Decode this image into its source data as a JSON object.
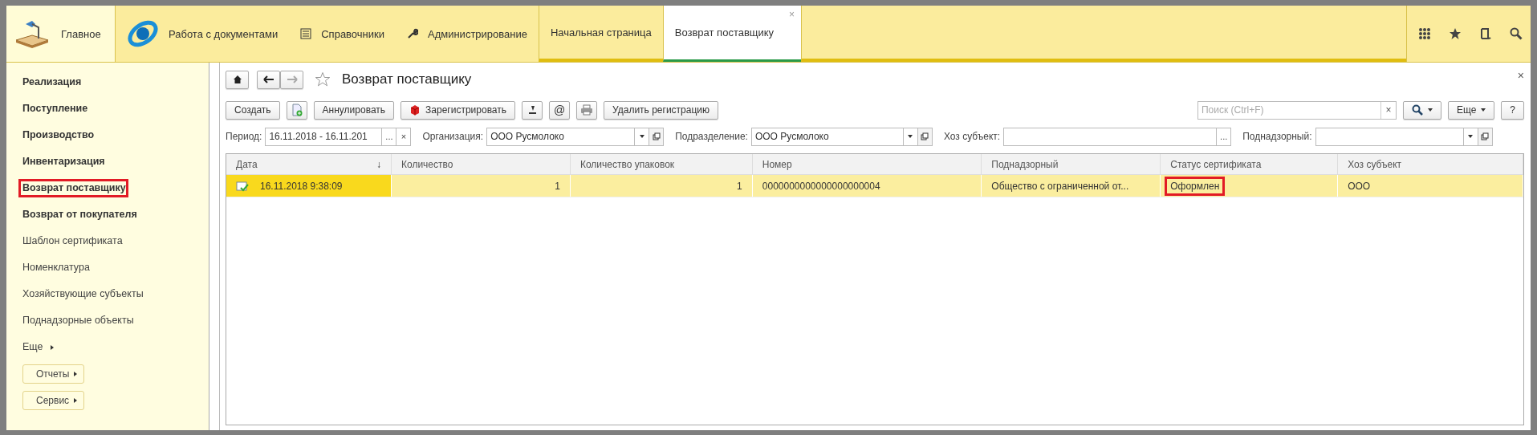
{
  "top_bar": {
    "home": {
      "label": "Главное",
      "selected": true
    },
    "sections": [
      {
        "label": "Работа с документами",
        "kind": "logo"
      },
      {
        "label": "Справочники",
        "kind": "list"
      },
      {
        "label": "Администрирование",
        "kind": "wrench"
      }
    ],
    "tabs": [
      {
        "label": "Начальная страница",
        "selected": false
      },
      {
        "label": "Возврат поставщику",
        "selected": true,
        "close": "×"
      }
    ]
  },
  "sidebar": {
    "items": [
      {
        "label": "Реализация",
        "kind": "section",
        "highlighted": false
      },
      {
        "label": "Поступление",
        "kind": "section",
        "highlighted": false
      },
      {
        "label": "Производство",
        "kind": "section",
        "highlighted": false
      },
      {
        "label": "Инвентаризация",
        "kind": "section",
        "highlighted": false
      },
      {
        "label": "Возврат поставщику",
        "kind": "section",
        "highlighted": true
      },
      {
        "label": "Возврат от покупателя",
        "kind": "section",
        "highlighted": false
      },
      {
        "label": "Шаблон сертификата",
        "kind": "link",
        "highlighted": false
      },
      {
        "label": "Номенклатура",
        "kind": "link",
        "highlighted": false
      },
      {
        "label": "Хозяйствующие субъекты",
        "kind": "link",
        "highlighted": false
      },
      {
        "label": "Поднадзорные объекты",
        "kind": "link",
        "highlighted": false
      },
      {
        "label": "Еще",
        "kind": "more",
        "highlighted": false
      },
      {
        "label": "Отчеты",
        "kind": "button",
        "highlighted": false
      },
      {
        "label": "Сервис",
        "kind": "button",
        "highlighted": false
      }
    ]
  },
  "form": {
    "title": "Возврат поставщику",
    "close": "×",
    "toolbar": {
      "create": "Создать",
      "annul": "Аннулировать",
      "register": "Зарегистрировать",
      "email": "@",
      "unregister": "Удалить регистрацию",
      "search_placeholder": "Поиск (Ctrl+F)",
      "search_clear": "×",
      "more": "Еще",
      "help": "?"
    },
    "filters": [
      {
        "label": "Период:",
        "kind": "period",
        "value": "16.11.2018 - 16.11.201",
        "choose_button": "...",
        "clear_button": "×"
      },
      {
        "label": "Организация:",
        "kind": "select",
        "value": "ООО Русмолоко"
      },
      {
        "label": "Подразделение:",
        "kind": "select",
        "value": "ООО Русмолоко"
      },
      {
        "label": "Хоз субъект:",
        "kind": "choose",
        "choose_button": "..."
      },
      {
        "label": "Поднадзорный:",
        "kind": "select"
      }
    ],
    "table": {
      "columns": [
        {
          "label": "Дата",
          "sort": "↓"
        },
        {
          "label": "Количество"
        },
        {
          "label": "Количество упаковок"
        },
        {
          "label": "Номер"
        },
        {
          "label": "Поднадзорный"
        },
        {
          "label": "Статус сертификата"
        },
        {
          "label": "Хоз субъект"
        }
      ],
      "rows": [
        {
          "selected": true,
          "cells": [
            {
              "text": "16.11.2018 9:38:09",
              "highlighted": false
            },
            {
              "text": "1",
              "highlighted": false
            },
            {
              "text": "1",
              "highlighted": false
            },
            {
              "text": "0000000000000000000004",
              "highlighted": false
            },
            {
              "text": "Общество с ограниченной от...",
              "highlighted": false
            },
            {
              "text": "Оформлен",
              "highlighted": true
            },
            {
              "text": "ООО",
              "highlighted": false
            }
          ]
        }
      ]
    }
  }
}
